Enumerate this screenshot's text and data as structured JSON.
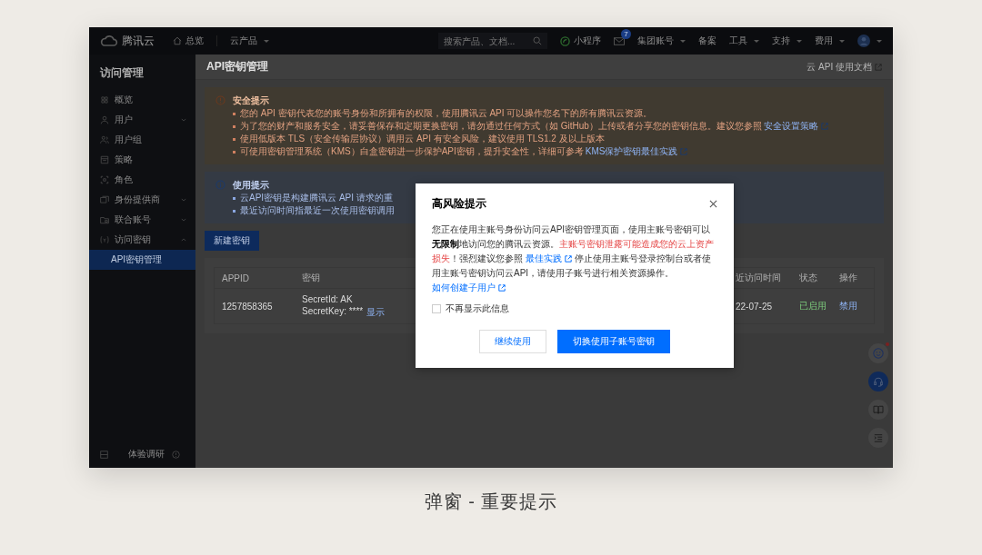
{
  "top_bar": {
    "brand": "腾讯云",
    "nav": [
      {
        "kind": "home",
        "label": "总览"
      },
      {
        "kind": "dropdown",
        "label": "云产品"
      }
    ],
    "search": {
      "placeholder": "搜索产品、文档..."
    },
    "items": [
      {
        "kind": "miniapp",
        "label": "小程序"
      },
      {
        "kind": "mail",
        "badge": "7"
      },
      {
        "kind": "dropdown",
        "label": "集团账号"
      },
      {
        "kind": "plain",
        "label": "备案"
      },
      {
        "kind": "dropdown",
        "label": "工具"
      },
      {
        "kind": "dropdown",
        "label": "支持"
      },
      {
        "kind": "dropdown",
        "label": "费用"
      },
      {
        "kind": "avatar"
      }
    ]
  },
  "sidebar": {
    "title": "访问管理",
    "items": [
      {
        "kind": "link",
        "label": "概览",
        "selected": false
      },
      {
        "kind": "group",
        "label": "用户",
        "selected": false,
        "expanded": false
      },
      {
        "kind": "link",
        "label": "用户组",
        "selected": false
      },
      {
        "kind": "link",
        "label": "策略",
        "selected": false
      },
      {
        "kind": "link",
        "label": "角色",
        "selected": false
      },
      {
        "kind": "group",
        "label": "身份提供商",
        "selected": false,
        "expanded": false
      },
      {
        "kind": "group",
        "label": "联合账号",
        "selected": false,
        "expanded": false
      },
      {
        "kind": "group",
        "label": "访问密钥",
        "selected": false,
        "expanded": true,
        "children": [
          {
            "label": "API密钥管理",
            "selected": true
          }
        ]
      }
    ],
    "footer": "体验调研"
  },
  "page": {
    "title": "API密钥管理",
    "doc_link": "云 API 使用文档"
  },
  "security_notice": {
    "title": "安全提示",
    "items": [
      {
        "text": "您的 API 密钥代表您的账号身份和所拥有的权限，使用腾讯云 API 可以操作您名下的所有腾讯云资源。"
      },
      {
        "text": "为了您的财产和服务安全，请妥善保存和定期更换密钥，请勿通过任何方式（如 GitHub）上传或者分享您的密钥信息。建议您参照",
        "link": "安全设置策略"
      },
      {
        "text": "使用低版本 TLS（安全传输层协议）调用云 API 有安全风险，建议使用 TLS1.2 及以上版本"
      },
      {
        "text": "可使用密钥管理系统（KMS）白盒密钥进一步保护API密钥，提升安全性，详细可参考",
        "link": "KMS保护密钥最佳实践"
      }
    ]
  },
  "usage_notice": {
    "title": "使用提示",
    "items": [
      {
        "text": "云API密钥是构建腾讯云 API 请求的重"
      },
      {
        "text": "最近访问时间指最近一次使用密钥调用"
      }
    ]
  },
  "new_button": "新建密钥",
  "table": {
    "columns": [
      "APPID",
      "密钥",
      "近访问时间",
      "状态",
      "操作"
    ],
    "rows": [
      {
        "appid": "1257858365",
        "secret_id": "SecretId: AK",
        "secret_key": "SecretKey: ****",
        "show_link": "显示",
        "last_access": "22-07-25",
        "status": "已启用",
        "action": "禁用"
      }
    ]
  },
  "dialog": {
    "title": "高风险提示",
    "body": [
      {
        "kind": "text",
        "text": "您正在使用主账号身份访问云API密钥管理页面，使用主账号密钥可以"
      },
      {
        "kind": "bold",
        "text": "无限制"
      },
      {
        "kind": "text",
        "text": "地访问您的腾讯云资源。"
      },
      {
        "kind": "warning",
        "text": "主账号密钥泄露可能造成您的云上资产损失"
      },
      {
        "kind": "text",
        "text": "！强烈建议您参照 "
      },
      {
        "kind": "link",
        "text": "最佳实践"
      },
      {
        "kind": "text",
        "text": " 停止使用主账号登录控制台或者使用主账号密钥访问云API，请使用子账号进行相关资源操作。"
      },
      {
        "kind": "link",
        "text": "如何创建子用户"
      }
    ],
    "checkbox": {
      "label": "不再显示此信息",
      "checked": false
    },
    "buttons": [
      {
        "kind": "secondary",
        "label": "继续使用"
      },
      {
        "kind": "primary",
        "label": "切换使用子账号密钥"
      }
    ]
  },
  "caption": "弹窗 - 重要提示"
}
